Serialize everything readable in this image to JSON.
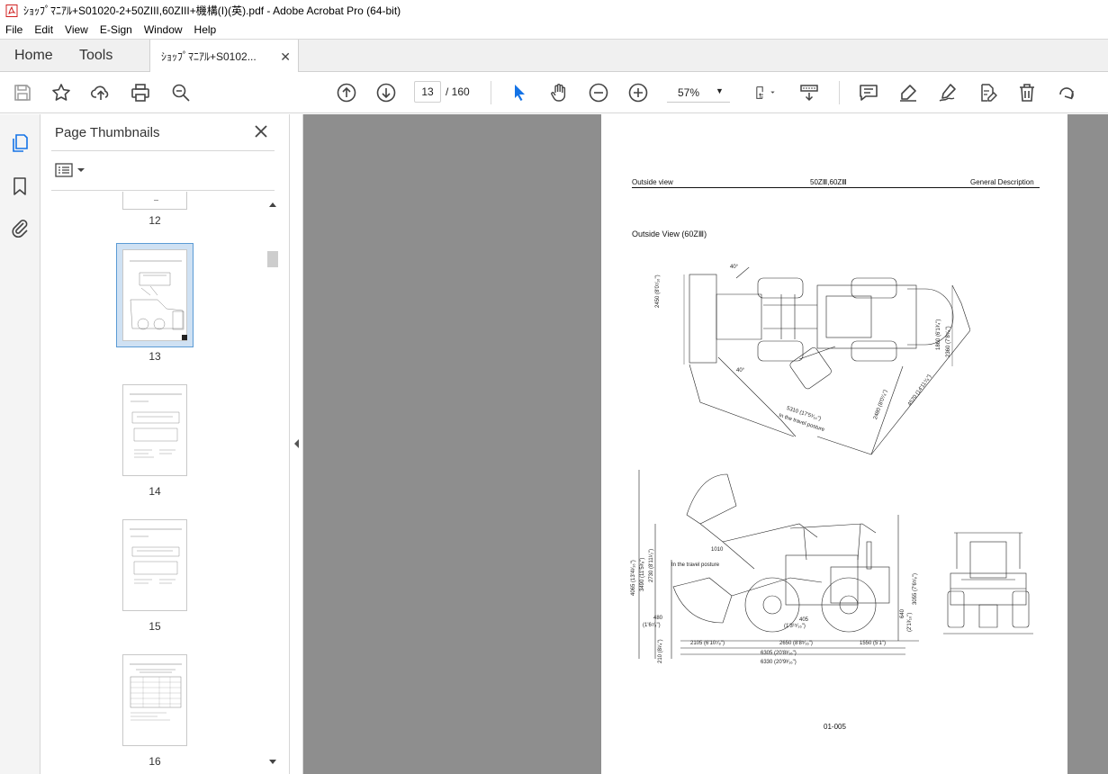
{
  "window": {
    "title": "ｼｮｯﾌﾟﾏﾆｱﾙ+S01020-2+50ZIII,60ZIII+機構(I)(英).pdf - Adobe Acrobat Pro (64-bit)"
  },
  "menu": [
    "File",
    "Edit",
    "View",
    "E-Sign",
    "Window",
    "Help"
  ],
  "tabs": {
    "home": "Home",
    "tools": "Tools",
    "document": "ｼｮｯﾌﾟﾏﾆｱﾙ+S0102...",
    "close_glyph": "✕"
  },
  "toolbar": {
    "current_page": "13",
    "page_total": "/  160",
    "zoom": "57%",
    "icons": [
      "save-icon",
      "star-icon",
      "upload-icon",
      "print-icon",
      "zoom-search-icon",
      "page-up-icon",
      "page-down-icon",
      "select-cursor-icon",
      "hand-icon",
      "zoom-out-icon",
      "zoom-in-icon",
      "fit-page-icon",
      "scroll-mode-icon",
      "comment-icon",
      "highlight-icon",
      "sign-icon",
      "edit-icon",
      "delete-icon",
      "rotate-icon"
    ]
  },
  "thumbnails": {
    "title": "Page Thumbnails",
    "items": [
      {
        "label": "12"
      },
      {
        "label": "13",
        "selected": true
      },
      {
        "label": "14"
      },
      {
        "label": "15"
      },
      {
        "label": "16"
      }
    ]
  },
  "pdf_page": {
    "header_left": "Outside view",
    "header_center": "50ZⅢ,60ZⅢ",
    "header_right": "General Description",
    "heading": "Outside View (60ZⅢ)",
    "dimensions_top": [
      "2450 (8'0⁷⁄₁₆\")",
      "1860 (6'1³⁄₄\")",
      "2360 (7'8⁷⁄₈\")",
      "5310 (17'5¹⁄₁₆\")",
      "In the travel posture",
      "2480 (8'0⁷⁄₈\")",
      "4570 (14'11⁷⁄₈\")",
      "40°",
      "40°"
    ],
    "dimensions_side": [
      "4065 (13'4¹⁄₁₆\")",
      "3490 (11'5³⁄₈\")",
      "2730 (8'11¹⁄₂\")",
      "1010",
      "In the travel posture",
      "480",
      "(1'6⁷⁄₈\")",
      "405",
      "(1'3¹⁵⁄₁₆\")",
      "3055 (7'6⁵⁄₈\")",
      "640",
      "(2'1³⁄₁₆\")",
      "210 (8¹⁄₄\")",
      "2105 (6'10⁷⁄₈\")",
      "2650 (8'8⁵⁄₁₆\")",
      "1550 (5'1\")",
      "6305 (20'8³⁄₁₆\")",
      "6330 (20'9³⁄₁₆\")"
    ],
    "page_number": "01-005"
  },
  "colors": {
    "accent": "#1473e6",
    "doc_background": "#8e8e8e",
    "selected_thumb_bg": "#cfe1f3"
  }
}
